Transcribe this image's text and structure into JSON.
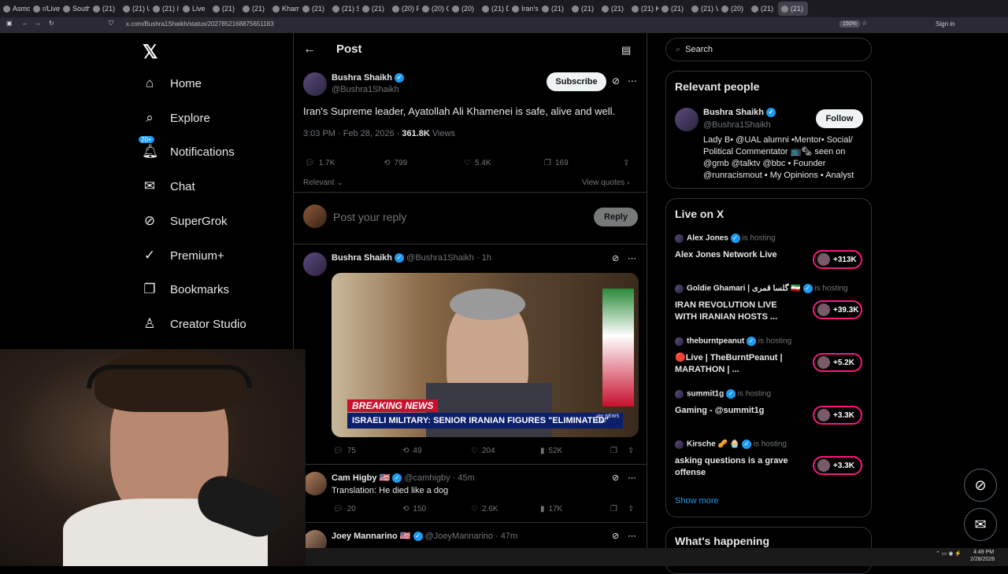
{
  "browser": {
    "tabs": [
      "Asmo",
      "r/Live",
      "South",
      "(21)",
      "(21) U",
      "(21) I",
      "Live",
      "(21)",
      "(21)",
      "Kham",
      "(21)",
      "(21) S",
      "(21)",
      "(20) F",
      "(20) C",
      "(20)",
      "(21) D",
      "Iran's",
      "(21)",
      "(21)",
      "(21)",
      "(21) K",
      "(21)",
      "(21) V",
      "(20)",
      "(21)",
      "(21)"
    ],
    "url": "x.com/Bushra1Shaikh/status/2027852168875651183",
    "zoom": "150%",
    "signin": "Sign in"
  },
  "nav": {
    "logo": "𝕏",
    "items": [
      {
        "icon": "home-icon",
        "glyph": "⌂",
        "label": "Home"
      },
      {
        "icon": "search-icon",
        "glyph": "⌕",
        "label": "Explore"
      },
      {
        "icon": "bell-icon",
        "glyph": "🔔︎",
        "label": "Notifications",
        "badge": "20+"
      },
      {
        "icon": "mail-icon",
        "glyph": "✉",
        "label": "Chat"
      },
      {
        "icon": "grok-icon",
        "glyph": "⊘",
        "label": "SuperGrok"
      },
      {
        "icon": "premium-icon",
        "glyph": "✓",
        "label": "Premium+"
      },
      {
        "icon": "bookmark-icon",
        "glyph": "❐",
        "label": "Bookmarks"
      },
      {
        "icon": "creator-icon",
        "glyph": "♙",
        "label": "Creator Studio"
      }
    ]
  },
  "post_header": {
    "back": "←",
    "title": "Post"
  },
  "tweet": {
    "name": "Bushra Shaikh",
    "handle": "@Bushra1Shaikh",
    "subscribe": "Subscribe",
    "text": "Iran's Supreme leader, Ayatollah Ali Khamenei is safe, alive and well.",
    "time": "3:03 PM · Feb 28, 2026 · ",
    "views_count": "361.8K",
    "views_label": " Views",
    "replies": "1.7K",
    "reposts": "799",
    "likes": "5.4K",
    "bookmarks": "169",
    "sort": "Relevant",
    "view_quotes": "View quotes"
  },
  "reply_box": {
    "placeholder": "Post your reply",
    "button": "Reply"
  },
  "reply1": {
    "name": "Bushra Shaikh",
    "handle": "@Bushra1Shaikh · 1h",
    "breaking": "BREAKING NEWS",
    "headline": "ISRAELI MILITARY: SENIOR IRANIAN FIGURES \"ELIMINATED\"",
    "network": "abc NEWS LIVE",
    "replies": "75",
    "reposts": "49",
    "likes": "204",
    "views": "52K"
  },
  "reply2": {
    "name": "Cam Higby 🇺🇸",
    "handle": "@camhigby · 45m",
    "text": "Translation: He died like a dog",
    "replies": "20",
    "reposts": "150",
    "likes": "2.6K",
    "views": "17K"
  },
  "reply3": {
    "name": "Joey Mannarino 🇺🇸",
    "handle": "@JoeyMannarino · 47m"
  },
  "search": {
    "placeholder": "Search"
  },
  "relevant": {
    "title": "Relevant people",
    "name": "Bushra Shaikh",
    "handle": "@Bushra1Shaikh",
    "follow": "Follow",
    "bio": "Lady B• @UAL alumni •Mentor• Social/ Political Commentator 📺🗞 seen on @gmb @talktv @bbc • Founder @runracismout • My Opinions • Analyst"
  },
  "live": {
    "title": "Live on X",
    "hosting": "is hosting",
    "items": [
      {
        "host": "Alex Jones",
        "title": "Alex Jones Network Live",
        "count": "+313K"
      },
      {
        "host": "Goldie Ghamari | گلسا قمری 🇮🇷",
        "title": "IRAN REVOLUTION LIVE WITH IRANIAN HOSTS ...",
        "count": "+39.3K"
      },
      {
        "host": "theburntpeanut",
        "title": "🔴Live | TheBurntPeanut | MARATHON | ...",
        "count": "+5.2K"
      },
      {
        "host": "summit1g",
        "title": "Gaming - @summit1g",
        "count": "+3.3K"
      },
      {
        "host": "Kirsche 🥜 🧁",
        "title": "asking questions is a grave offense",
        "count": "+3.3K"
      }
    ],
    "show_more": "Show more"
  },
  "happening": {
    "title": "What's happening"
  },
  "taskbar": {
    "time": "4:49 PM",
    "date": "2/28/2026"
  }
}
